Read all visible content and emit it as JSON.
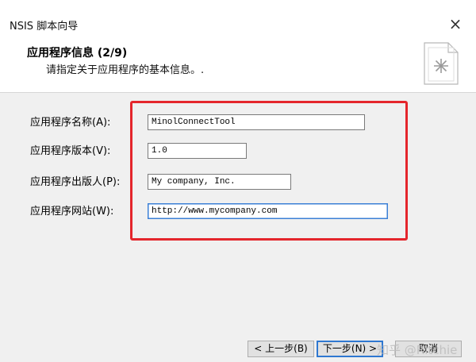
{
  "window": {
    "title": "NSIS 脚本向导",
    "close_label": "×"
  },
  "header": {
    "title": "应用程序信息 (2/9)",
    "subtitle": "请指定关于应用程序的基本信息。."
  },
  "form": {
    "fields": [
      {
        "label": "应用程序名称(A):",
        "value": "MinolConnectTool"
      },
      {
        "label": "应用程序版本(V):",
        "value": "1.0"
      },
      {
        "label": "应用程序出版人(P):",
        "value": "My company, Inc."
      },
      {
        "label": "应用程序网站(W):",
        "value": "http://www.mycompany.com"
      }
    ]
  },
  "footer": {
    "back_label": "< 上一步(B)",
    "next_label": "下一步(N) >",
    "cancel_label": "取消"
  },
  "watermark": "知乎 @Ritchie",
  "icons": {
    "header": "wizard-document-icon",
    "close": "close-icon"
  },
  "colors": {
    "highlight_box": "#e4262c",
    "focus_border": "#3b7fd6"
  }
}
